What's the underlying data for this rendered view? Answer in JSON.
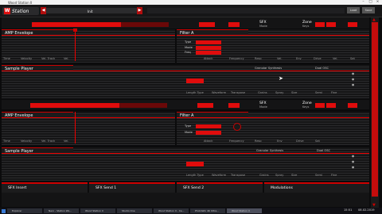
{
  "window": {
    "title": "Wood Station II"
  },
  "header": {
    "logo_text": "Station",
    "logo_mark": "W",
    "prev": "◀",
    "next": "▶",
    "preset": "Init",
    "btn_a": "Load",
    "btn_b": "Save"
  },
  "layer1": {
    "top_labels": {
      "sfx": "SFX",
      "mode": "Mode",
      "zone": "Zone",
      "keys": "Keys"
    },
    "amp": {
      "title": "AMP Envelope",
      "params": [
        "Time",
        "Velocity",
        "Vel. Track",
        "Vel."
      ]
    },
    "filter": {
      "title": "Filter A",
      "rows": [
        "Type",
        "Mode",
        "Freq"
      ],
      "params": [
        "Attack",
        "Frequency",
        "Reso",
        "Vel.",
        "Env",
        "Drive",
        "Vel.",
        "Sat"
      ]
    },
    "sample": {
      "title": "Sample Player",
      "top": [
        "Granular Synthesis",
        "Dual OSC"
      ],
      "params": [
        "Length Type",
        "Waveform",
        "Transpose",
        "Grains",
        "Spray",
        "Size",
        "Semi",
        "Fine"
      ]
    }
  },
  "layer2": {
    "top_labels": {
      "sfx": "SFX",
      "mode": "Mode",
      "zone": "Zone",
      "keys": "Keys"
    },
    "amp": {
      "title": "AMP Envelope",
      "params": [
        "Time",
        "Velocity",
        "Vel. Track",
        "Vel."
      ]
    },
    "filter": {
      "title": "Filter A",
      "rows": [
        "Type",
        "Mode"
      ],
      "params": [
        "Attack",
        "Frequency",
        "Reso",
        "Env",
        "Drive",
        "Sat"
      ]
    },
    "sample": {
      "title": "Sample Player",
      "top": [
        "Granular Synthesis",
        "Dual OSC"
      ],
      "params": [
        "Length Type",
        "Waveform",
        "Transpose",
        "Grains",
        "Spray",
        "Size",
        "Semi",
        "Fine"
      ]
    }
  },
  "tabs": [
    "SFX Insert",
    "SFX Send 1",
    "SFX Send 2",
    "Modulations"
  ],
  "taskbar": {
    "items": [
      "Explorer",
      "Nero - Station Wo...",
      "Wood Station II",
      "Studio One",
      "Wood Station II - Ca...",
      "PhotoWin 4K Ultra...",
      "Wood Station II"
    ],
    "clock": "15:51",
    "date": "08.02.2019"
  },
  "colors": {
    "accent": "#e00c0c",
    "dark_accent": "#5a0707",
    "background": "#141415"
  }
}
